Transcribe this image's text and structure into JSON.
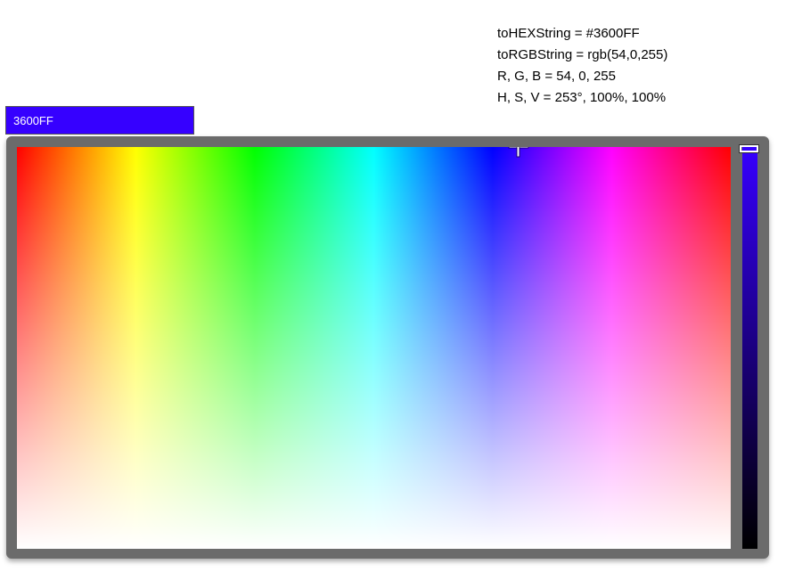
{
  "info": {
    "hex_line": "toHEXString = #3600FF",
    "rgb_line": "toRGBString = rgb(54,0,255)",
    "rgb_values_line": "R, G, B = 54, 0, 255",
    "hsv_line": "H, S, V = 253°, 100%, 100%"
  },
  "color_input": {
    "value": "3600FF",
    "background": "#3600FF",
    "text_color": "#FFFFFF"
  },
  "picker": {
    "hue_deg": 253,
    "saturation_pct": 100,
    "value_pct": 100,
    "frame_color": "#6B6B6B"
  },
  "icons": {
    "pad_pointer": "crosshair-icon",
    "slider_pointer": "slider-handle"
  }
}
